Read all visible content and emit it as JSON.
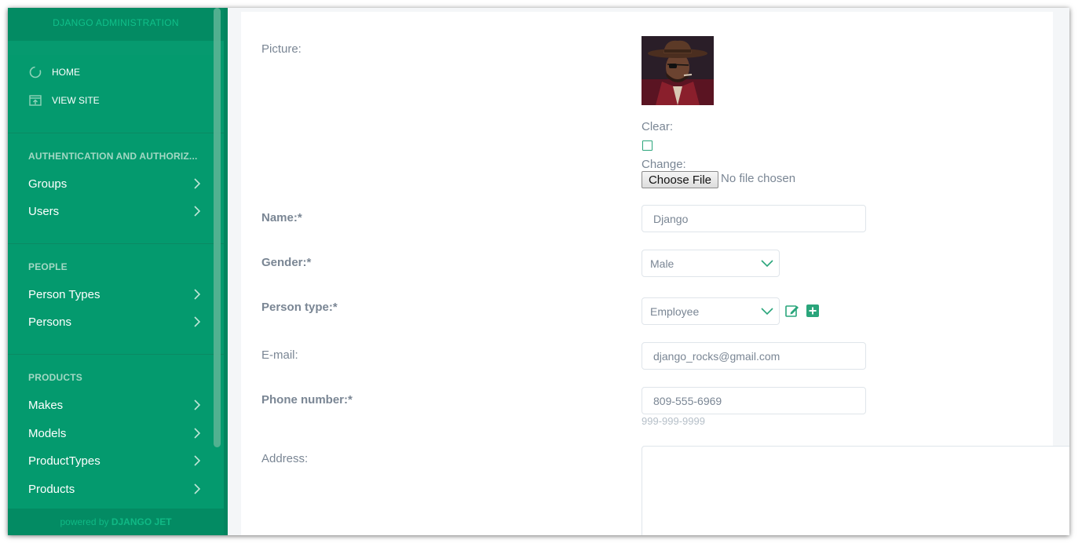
{
  "sidebar": {
    "title": "DJANGO ADMINISTRATION",
    "top_links": [
      {
        "label": "HOME",
        "icon": "dashboard-icon"
      },
      {
        "label": "VIEW SITE",
        "icon": "open-site-icon"
      }
    ],
    "sections": [
      {
        "heading": "AUTHENTICATION AND AUTHORIZ...",
        "items": [
          "Groups",
          "Users"
        ]
      },
      {
        "heading": "PEOPLE",
        "items": [
          "Person Types",
          "Persons"
        ]
      },
      {
        "heading": "PRODUCTS",
        "items": [
          "Makes",
          "Models",
          "ProductTypes",
          "Products"
        ]
      }
    ],
    "footer": {
      "prefix": "powered by ",
      "brand": "DJANGO JET"
    }
  },
  "form": {
    "picture": {
      "label": "Picture:",
      "clear_label": "Clear:",
      "change_label": "Change:",
      "choose_button": "Choose File",
      "file_status": "No file chosen"
    },
    "name": {
      "label": "Name:*",
      "value": "Django"
    },
    "gender": {
      "label": "Gender:*",
      "value": "Male"
    },
    "person_type": {
      "label": "Person type:*",
      "value": "Employee"
    },
    "email": {
      "label": "E-mail:",
      "value": "django_rocks@gmail.com"
    },
    "phone": {
      "label": "Phone number:*",
      "value": "809-555-6969",
      "help": "999-999-9999"
    },
    "address": {
      "label": "Address:",
      "value": ""
    }
  },
  "colors": {
    "sidebar": "#049a6e",
    "accent": "#2aa57b"
  }
}
